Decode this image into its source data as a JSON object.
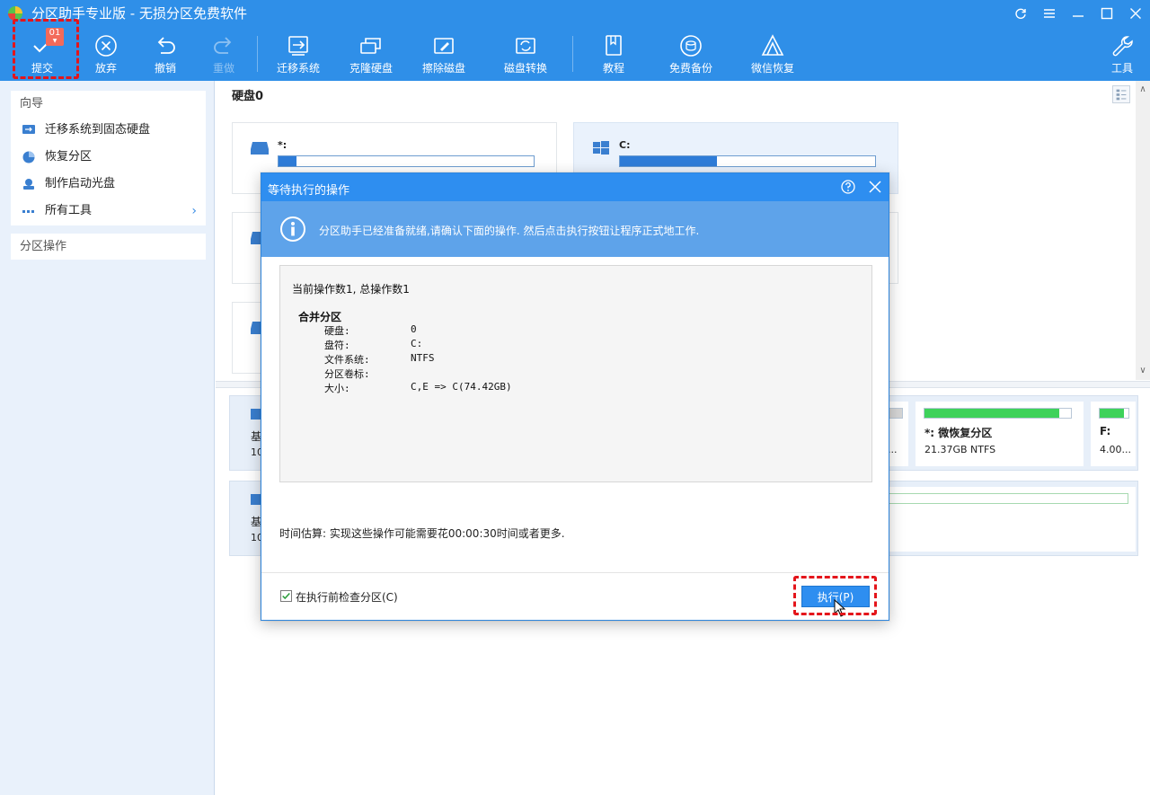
{
  "app": {
    "title": "分区助手专业版 - 无损分区免费软件"
  },
  "toolbar": {
    "commit": {
      "label": "提交",
      "badge": "01"
    },
    "discard": "放弃",
    "undo": "撤销",
    "redo": "重做",
    "migrate": "迁移系统",
    "clone": "克隆硬盘",
    "wipe": "擦除磁盘",
    "convert": "磁盘转换",
    "tutorial": "教程",
    "backup": "免费备份",
    "wechat": "微信恢复",
    "tools": "工具"
  },
  "sidebar": {
    "wizard_title": "向导",
    "wizard_items": [
      {
        "label": "迁移系统到固态硬盘",
        "icon": "migrate-ssd-icon"
      },
      {
        "label": "恢复分区",
        "icon": "recover-partition-icon"
      },
      {
        "label": "制作启动光盘",
        "icon": "bootable-disc-icon"
      },
      {
        "label": "所有工具",
        "icon": "all-tools-icon"
      }
    ],
    "ops_title": "分区操作"
  },
  "main": {
    "disk_label": "硬盘0",
    "partitions": [
      {
        "name": "*:",
        "usage": 0.07
      },
      {
        "name": "C:",
        "usage": 0.38
      }
    ]
  },
  "disk_strips": {
    "row1": {
      "label": "基",
      "size": "10",
      "cells": [
        {
          "name": "",
          "info": "1..."
        },
        {
          "name": "*: 微恢复分区",
          "info": "21.37GB NTFS",
          "usage": 0.92
        },
        {
          "name": "F:",
          "info": "4.00...",
          "usage": 0.85
        }
      ]
    },
    "row2": {
      "label": "基",
      "size": "10"
    }
  },
  "dialog": {
    "title": "等待执行的操作",
    "banner": "分区助手已经准备就绪,请确认下面的操作. 然后点击执行按钮让程序正式地工作.",
    "count_text": "当前操作数1, 总操作数1",
    "op_name": "合并分区",
    "details": [
      {
        "key": "硬盘:",
        "value": "0"
      },
      {
        "key": "盘符:",
        "value": "C:"
      },
      {
        "key": "文件系统:",
        "value": "NTFS"
      },
      {
        "key": "分区卷标:",
        "value": ""
      },
      {
        "key": "大小:",
        "value": "C,E => C(74.42GB)"
      }
    ],
    "estimate": "时间估算: 实现这些操作可能需要花00:00:30时间或者更多.",
    "check_label": "在执行前检查分区(C)",
    "checked": true,
    "execute_label": "执行(P)"
  },
  "colors": {
    "brand": "#2f8fe8",
    "highlight": "#e4151b",
    "accent_green": "#3ed25b"
  }
}
